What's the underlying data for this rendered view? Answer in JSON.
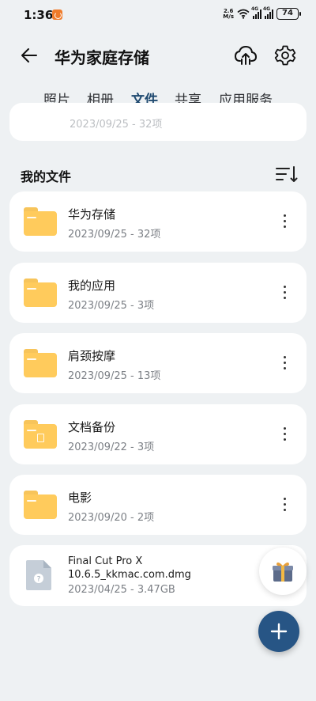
{
  "status_bar": {
    "time": "1:36",
    "net_speed_value": "2.6",
    "net_speed_unit": "M/s",
    "signal_labels": [
      "4G",
      "4G"
    ],
    "battery": "74"
  },
  "header": {
    "title": "华为家庭存储"
  },
  "tabs": [
    {
      "label": "照片",
      "active": false
    },
    {
      "label": "相册",
      "active": false
    },
    {
      "label": "文件",
      "active": true
    },
    {
      "label": "共享",
      "active": false
    },
    {
      "label": "应用服务",
      "active": false
    }
  ],
  "previous_card_text": "2023/09/25 - 32项",
  "section": {
    "title": "我的文件"
  },
  "folders": [
    {
      "name": "华为存储",
      "meta": "2023/09/25 - 32项"
    },
    {
      "name": "我的应用",
      "meta": "2023/09/25 - 3项"
    },
    {
      "name": "肩颈按摩",
      "meta": "2023/09/25 - 13项"
    },
    {
      "name": "文档备份",
      "meta": "2023/09/22 - 3项"
    },
    {
      "name": "电影",
      "meta": "2023/09/20 - 2项"
    }
  ],
  "file": {
    "name_line1": "Final Cut Pro X",
    "name_line2": "10.6.5_kkmac.com.dmg",
    "meta": "2023/04/25 - 3.47GB"
  },
  "colors": {
    "accent": "#1f4a70",
    "fab": "#275585",
    "folder": "#ffcb5c",
    "background": "#eef1f3"
  },
  "icons": {
    "back": "arrow-left-icon",
    "cloud": "cloud-upload-icon",
    "settings": "gear-icon",
    "sort": "sort-icon",
    "more": "more-vertical-icon",
    "gift": "gift-icon",
    "add": "plus-icon"
  }
}
